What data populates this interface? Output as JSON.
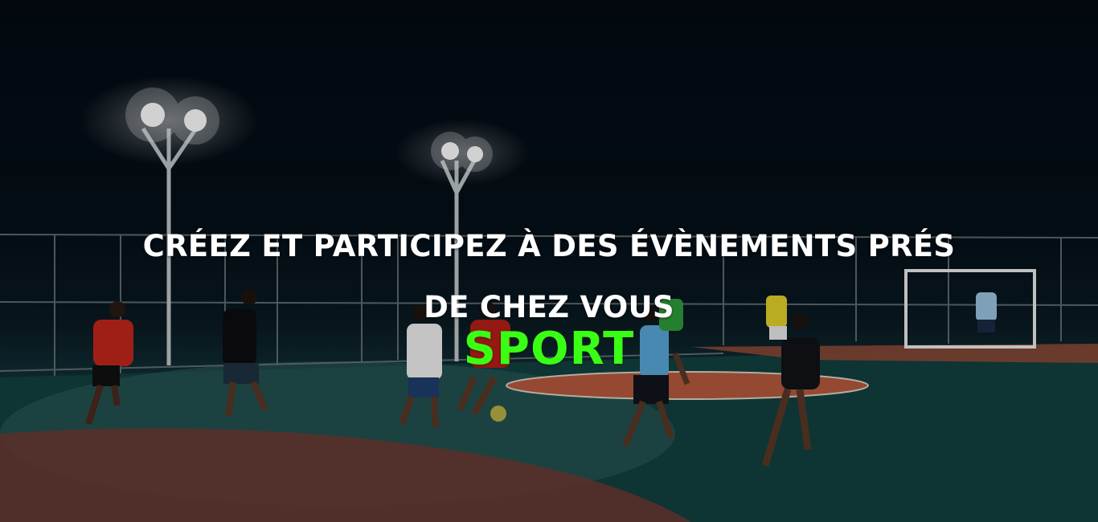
{
  "hero": {
    "headline_line1": "CRÉEZ ET PARTICIPEZ À DES ÉVÈNEMENTS PRÉS",
    "headline_line2": "DE CHEZ VOUS",
    "accent_word": "SPORT",
    "accent_color": "#39ff14",
    "background_image": "night-futsal-court-photo"
  }
}
